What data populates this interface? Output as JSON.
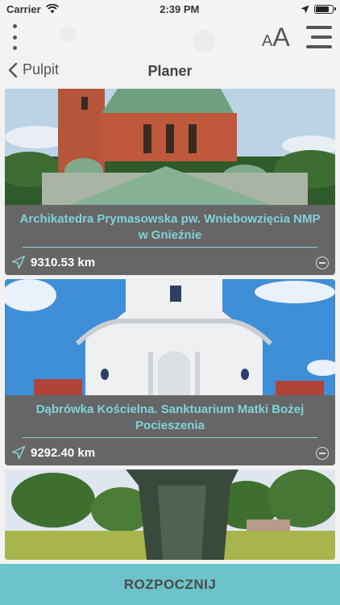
{
  "status": {
    "carrier": "Carrier",
    "time": "2:39 PM",
    "battery_level": 0.9
  },
  "topbar": {
    "font_small": "A",
    "font_big": "A"
  },
  "nav": {
    "back_label": "Pulpit",
    "title": "Planer"
  },
  "cards": [
    {
      "name": "Archikatedra Prymasowska pw. Wniebowzięcia NMP w Gnieźnie",
      "distance": "9310.53 km"
    },
    {
      "name": "Dąbrówka Kościelna. Sanktuarium Matki Bożej Pocieszenia",
      "distance": "9292.40 km"
    }
  ],
  "start_button": "ROZPOCZNIJ",
  "colors": {
    "accent": "#6cc3ca",
    "card_bg": "#666666",
    "title_text": "#7fd3dc"
  }
}
